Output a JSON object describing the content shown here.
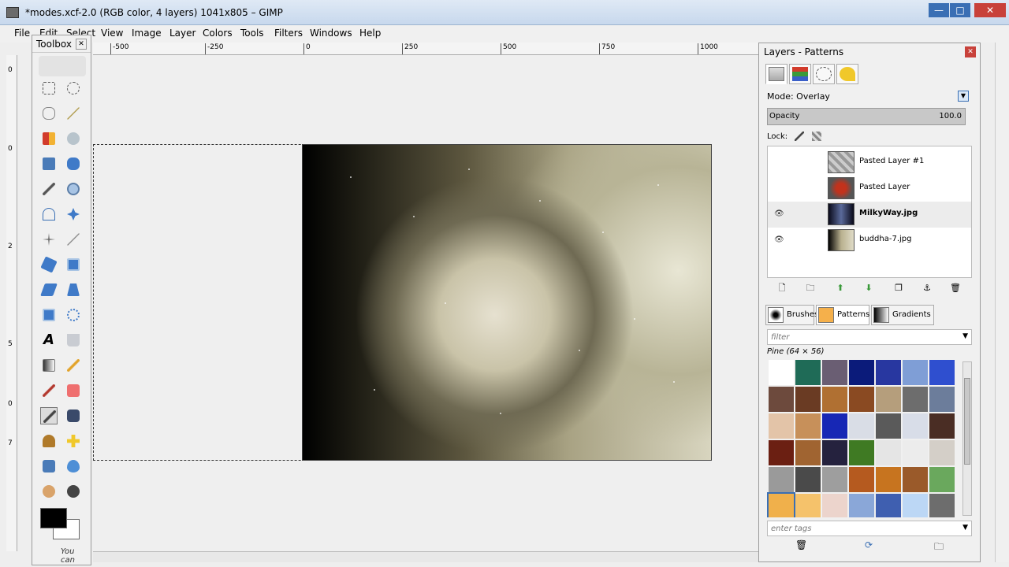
{
  "window": {
    "title": "*modes.xcf-2.0 (RGB color, 4 layers) 1041x805 – GIMP",
    "minimize": "—",
    "maximize": "□",
    "close": "✕"
  },
  "menubar": [
    "File",
    "Edit",
    "Select",
    "View",
    "Image",
    "Layer",
    "Colors",
    "Tools",
    "Filters",
    "Windows",
    "Help"
  ],
  "ruler": {
    "horizontal": [
      "-500",
      "-250",
      "0",
      "250",
      "500",
      "750",
      "1000"
    ],
    "vertical": [
      "0",
      "0",
      "2",
      "5",
      "0",
      "7"
    ]
  },
  "toolbox": {
    "title": "Toolbox",
    "close": "✕",
    "active_tool": "path-tool",
    "foreground_color": "#000000",
    "background_color": "#ffffff",
    "footer_text": "You can"
  },
  "layers_dock": {
    "title": "Layers - Patterns",
    "close": "✕",
    "mode_label": "Mode: Overlay",
    "opacity_label": "Opacity",
    "opacity_value": "100.0",
    "lock_label": "Lock:",
    "layers": [
      {
        "name": "Pasted Layer #1",
        "visible": false,
        "selected": false
      },
      {
        "name": "Pasted Layer",
        "visible": false,
        "selected": false
      },
      {
        "name": "MilkyWay.jpg",
        "visible": true,
        "selected": true
      },
      {
        "name": "buddha-7.jpg",
        "visible": true,
        "selected": false
      }
    ]
  },
  "patterns_panel": {
    "tabs": [
      "Brushes",
      "Patterns",
      "Gradients"
    ],
    "selected_tab": "Patterns",
    "filter_placeholder": "filter",
    "selected_pattern": "Pine (64 × 56)",
    "tags_placeholder": "enter tags",
    "swatches": [
      "#ffffff",
      "#1f6b57",
      "#6a5e73",
      "#0b1b7a",
      "#2837a0",
      "#7f9ed6",
      "#2f4fcf",
      "#6d4a3d",
      "#6a3b23",
      "#b07032",
      "#8a4a22",
      "#b59e7c",
      "#6d6d6d",
      "#6c7d9b",
      "#e3c4a8",
      "#c7905a",
      "#1727b5",
      "#d9dde6",
      "#5a5a5a",
      "#d8dde8",
      "#4a2d24",
      "#6b1f12",
      "#a06431",
      "#25223e",
      "#3f7a23",
      "#e5e5e5",
      "#ececec",
      "#d4cfc8",
      "#9a9a9a",
      "#4a4a4a",
      "#9e9e9e",
      "#b55a1f",
      "#c7741f",
      "#9a5a2a",
      "#6aa85d",
      "#f0b04b",
      "#f5c26b",
      "#ecd4cc",
      "#8aa7d8",
      "#3f5fb0",
      "#bcd7f5",
      "#6d6d6d"
    ]
  }
}
